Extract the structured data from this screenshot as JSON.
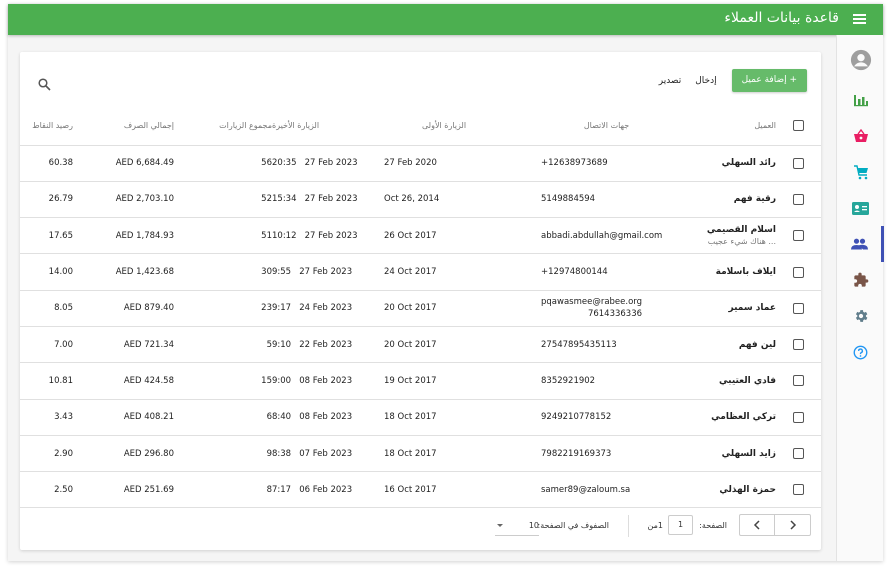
{
  "header": {
    "title": "قاعدة بيانات العملاء",
    "menu_icon": "menu-icon"
  },
  "sidebar": {
    "items": [
      {
        "icon": "account-circle-icon",
        "color": "#9e9e9e",
        "active": false
      },
      {
        "icon": "bar-chart-icon",
        "color": "#43a047",
        "active": false
      },
      {
        "icon": "shopping-basket-icon",
        "color": "#e91e63",
        "active": false
      },
      {
        "icon": "cart-icon",
        "color": "#00acc1",
        "active": false
      },
      {
        "icon": "contact-card-icon",
        "color": "#26a69a",
        "active": false
      },
      {
        "icon": "people-icon",
        "color": "#3f51b5",
        "active": true
      },
      {
        "icon": "extension-icon",
        "color": "#795548",
        "active": false
      },
      {
        "icon": "settings-icon",
        "color": "#607d8b",
        "active": false
      },
      {
        "icon": "help-icon",
        "color": "#2196f3",
        "active": false
      }
    ]
  },
  "toolbar": {
    "add_label": "+ إضافة عميل",
    "import_label": "إدخال",
    "export_label": "تصدير",
    "search_icon": "search-icon"
  },
  "table": {
    "columns": {
      "customer": "العميل",
      "contact": "جهات الاتصال",
      "first_visit": "الزيارة الأولى",
      "last_visit": "الزيارة الأخيرة",
      "total_visits": "مجموع الزيارات",
      "total_spend": "إجمالي الصرف",
      "points": "رصيد النقاط"
    },
    "rows": [
      {
        "name": "رائد السهلي",
        "sub": "",
        "contact": "+12638973689",
        "contact2": "",
        "first": "27 Feb 2020",
        "last_date": "27 Feb 2023",
        "last_time": "20:35",
        "visits": "56",
        "spend": "AED 6,684.49",
        "points": "60.38"
      },
      {
        "name": "رقية فهم",
        "sub": "",
        "contact": "5149884594",
        "contact2": "",
        "first": "Oct 26, 2014",
        "last_date": "27 Feb 2023",
        "last_time": "15:34",
        "visits": "52",
        "spend": "AED 2,703.10",
        "points": "26.79"
      },
      {
        "name": "اسلام القصيمي",
        "sub": "... هناك شيء عجيب",
        "contact": "abbadi.abdullah@gmail.com",
        "contact2": "",
        "first": "26 Oct 2017",
        "last_date": "27 Feb 2023",
        "last_time": "10:12",
        "visits": "51",
        "spend": "AED 1,784.93",
        "points": "17.65"
      },
      {
        "name": "ايلاف باسلامة",
        "sub": "",
        "contact": "+12974800144",
        "contact2": "",
        "first": "24 Oct 2017",
        "last_date": "27 Feb 2023",
        "last_time": "9:55",
        "visits": "30",
        "spend": "AED 1,423.68",
        "points": "14.00"
      },
      {
        "name": "عماد سمير",
        "sub": "",
        "contact": "pqawasmee@rabee.org",
        "contact2": "7614336336",
        "first": "20 Oct 2017",
        "last_date": "24 Feb 2023",
        "last_time": "9:17",
        "visits": "23",
        "spend": "AED 879.40",
        "points": "8.05"
      },
      {
        "name": "لين فهم",
        "sub": "",
        "contact": "27547895435113",
        "contact2": "",
        "first": "20 Oct 2017",
        "last_date": "22 Feb 2023",
        "last_time": "9:10",
        "visits": "5",
        "spend": "AED 721.34",
        "points": "7.00"
      },
      {
        "name": "فادي العتيبي",
        "sub": "",
        "contact": "8352921902",
        "contact2": "",
        "first": "19 Oct 2017",
        "last_date": "08 Feb 2023",
        "last_time": "9:00",
        "visits": "15",
        "spend": "AED 424.58",
        "points": "10.81"
      },
      {
        "name": "تركي العظامي",
        "sub": "",
        "contact": "9249210778152",
        "contact2": "",
        "first": "18 Oct 2017",
        "last_date": "08 Feb 2023",
        "last_time": "8:40",
        "visits": "6",
        "spend": "AED 408.21",
        "points": "3.43"
      },
      {
        "name": "زايد السهلي",
        "sub": "",
        "contact": "7982219169373",
        "contact2": "",
        "first": "18 Oct 2017",
        "last_date": "07 Feb 2023",
        "last_time": "8:38",
        "visits": "9",
        "spend": "AED 296.80",
        "points": "2.90"
      },
      {
        "name": "حمزة الهذلي",
        "sub": "",
        "contact": "samer89@zaloum.sa",
        "contact2": "",
        "first": "16 Oct 2017",
        "last_date": "06 Feb 2023",
        "last_time": "7:17",
        "visits": "8",
        "spend": "AED 251.69",
        "points": "2.50"
      }
    ]
  },
  "footer": {
    "page_label": "الصفحة:",
    "page_value": "1",
    "page_of": "1من",
    "rows_label": "الصفوف في الصفحة:",
    "rows_value": "10"
  }
}
